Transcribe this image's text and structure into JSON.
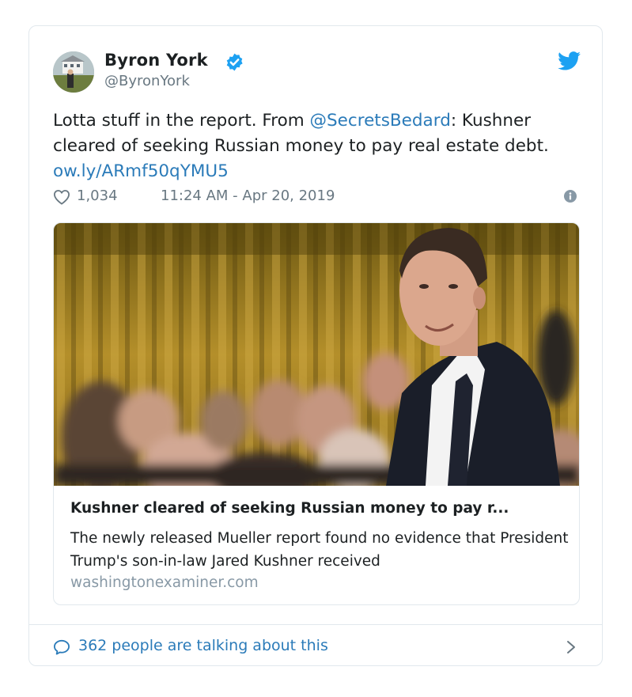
{
  "tweet": {
    "author_name": "Byron York",
    "author_handle": "@ByronYork",
    "text_before": "Lotta stuff in the report. From ",
    "mention": "@SecretsBedard",
    "text_middle": ": Kushner cleared of seeking Russian money to pay real estate debt. ",
    "url": "ow.ly/ARmf50qYMU5",
    "likes": "1,034",
    "timestamp": "11:24 AM - Apr 20, 2019"
  },
  "link_preview": {
    "title": "Kushner cleared of seeking Russian money to pay r...",
    "description": "The newly released Mueller report found no evidence that President Trump's son-in-law Jared Kushner received",
    "domain": "washingtonexaminer.com"
  },
  "footer": {
    "talking": "362 people are talking about this"
  },
  "icons": {
    "verified": "verified-badge-icon",
    "logo": "twitter-bird-icon",
    "like": "heart-icon",
    "info": "info-icon",
    "reply": "speech-bubble-icon",
    "more": "chevron-right-icon"
  },
  "colors": {
    "link": "#2b7bb9",
    "brand": "#1da1f2",
    "muted": "#697882"
  }
}
